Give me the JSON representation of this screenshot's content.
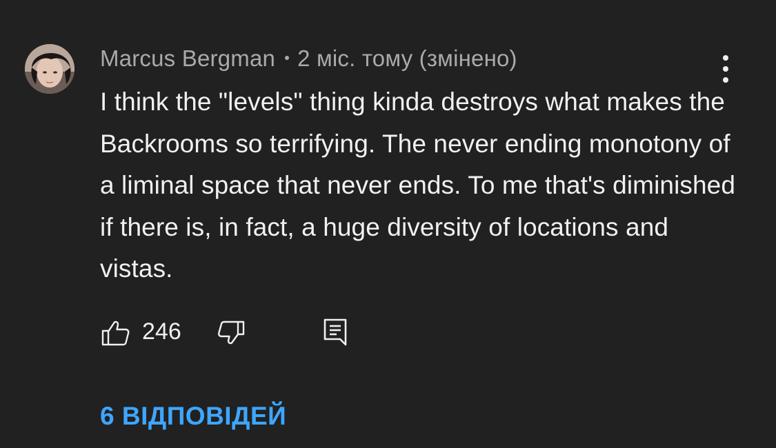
{
  "comment": {
    "author": "Marcus Bergman",
    "time": "2 міс. тому (змінено)",
    "text": "I think the \"levels\" thing kinda destroys what makes the Backrooms so terrifying. The never ending monotony of a liminal space that never ends. To me that's diminished if there is, in fact, a huge diversity of locations and vistas.",
    "like_count": "246",
    "replies_label": "6 ВІДПОВІДЕЙ"
  },
  "icons": {
    "avatar": "avatar-photo",
    "like": "thumbs-up-icon",
    "dislike": "thumbs-down-icon",
    "reply": "comment-reply-icon",
    "more": "more-vertical-icon"
  },
  "colors": {
    "background": "#212121",
    "text_primary": "#f1f1f1",
    "text_secondary": "#aaaaaa",
    "link": "#3ea6ff"
  }
}
